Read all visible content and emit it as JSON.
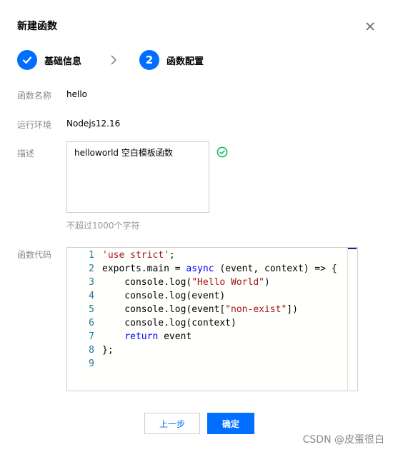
{
  "dialog": {
    "title": "新建函数"
  },
  "steps": [
    {
      "number": "1",
      "label": "基础信息",
      "state": "done"
    },
    {
      "number": "2",
      "label": "函数配置",
      "state": "active"
    }
  ],
  "form": {
    "name": {
      "label": "函数名称",
      "value": "hello"
    },
    "runtime": {
      "label": "运行环境",
      "value": "Nodejs12.16"
    },
    "description": {
      "label": "描述",
      "value": "helloworld 空白模板函数",
      "hint": "不超过1000个字符"
    },
    "code": {
      "label": "函数代码",
      "lines": [
        {
          "num": "1",
          "text": "'use strict';"
        },
        {
          "num": "2",
          "text": "exports.main = async (event, context) => {"
        },
        {
          "num": "3",
          "text": "    console.log(\"Hello World\")"
        },
        {
          "num": "4",
          "text": "    console.log(event)"
        },
        {
          "num": "5",
          "text": "    console.log(event[\"non-exist\"])"
        },
        {
          "num": "6",
          "text": "    console.log(context)"
        },
        {
          "num": "7",
          "text": "    return event"
        },
        {
          "num": "8",
          "text": "};"
        },
        {
          "num": "9",
          "text": ""
        }
      ]
    }
  },
  "buttons": {
    "prev": "上一步",
    "confirm": "确定"
  },
  "watermark": "CSDN @皮蛋很白",
  "colors": {
    "primary": "#006eff",
    "success": "#0abf5b"
  }
}
